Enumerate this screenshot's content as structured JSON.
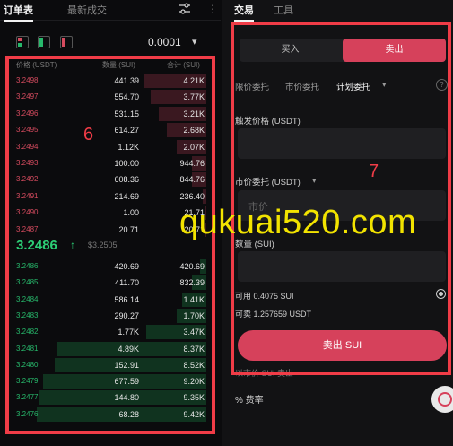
{
  "left_tabs": {
    "orderbook": "订单表",
    "trades": "最新成交"
  },
  "precision": "0.0001",
  "book_header": {
    "price": "价格 (USDT)",
    "qty": "数量 (SUI)",
    "total": "合计 (SUI)"
  },
  "asks": [
    {
      "price": "3.2498",
      "qty": "441.39",
      "total": "4.21K",
      "depth": 0.31
    },
    {
      "price": "3.2497",
      "qty": "554.70",
      "total": "3.77K",
      "depth": 0.28
    },
    {
      "price": "3.2496",
      "qty": "531.15",
      "total": "3.21K",
      "depth": 0.24
    },
    {
      "price": "3.2495",
      "qty": "614.27",
      "total": "2.68K",
      "depth": 0.2
    },
    {
      "price": "3.2494",
      "qty": "1.12K",
      "total": "2.07K",
      "depth": 0.15
    },
    {
      "price": "3.2493",
      "qty": "100.00",
      "total": "944.76",
      "depth": 0.07
    },
    {
      "price": "3.2492",
      "qty": "608.36",
      "total": "844.76",
      "depth": 0.07
    },
    {
      "price": "3.2491",
      "qty": "214.69",
      "total": "236.40",
      "depth": 0.02
    },
    {
      "price": "3.2490",
      "qty": "1.00",
      "total": "21.71",
      "depth": 0.01
    },
    {
      "price": "3.2487",
      "qty": "20.71",
      "total": "20.71",
      "depth": 0.01
    }
  ],
  "last_price": "3.2486",
  "mark_price": "$3.2505",
  "bids": [
    {
      "price": "3.2486",
      "qty": "420.69",
      "total": "420.69",
      "depth": 0.03
    },
    {
      "price": "3.2485",
      "qty": "411.70",
      "total": "832.39",
      "depth": 0.07
    },
    {
      "price": "3.2484",
      "qty": "586.14",
      "total": "1.41K",
      "depth": 0.12
    },
    {
      "price": "3.2483",
      "qty": "290.27",
      "total": "1.70K",
      "depth": 0.15
    },
    {
      "price": "3.2482",
      "qty": "1.77K",
      "total": "3.47K",
      "depth": 0.3
    },
    {
      "price": "3.2481",
      "qty": "4.89K",
      "total": "8.37K",
      "depth": 0.75
    },
    {
      "price": "3.2480",
      "qty": "152.91",
      "total": "8.52K",
      "depth": 0.76
    },
    {
      "price": "3.2479",
      "qty": "677.59",
      "total": "9.20K",
      "depth": 0.82
    },
    {
      "price": "3.2477",
      "qty": "144.80",
      "total": "9.35K",
      "depth": 0.84
    },
    {
      "price": "3.2476",
      "qty": "68.28",
      "total": "9.42K",
      "depth": 0.85
    }
  ],
  "right_tabs": {
    "trade": "交易",
    "tools": "工具"
  },
  "side": {
    "buy": "买入",
    "sell": "卖出"
  },
  "order_types": {
    "limit": "限价委托",
    "market": "市价委托",
    "plan": "计划委托"
  },
  "help_icon": "?",
  "trigger_label": "触发价格 (USDT)",
  "market_label": "市价委托 (USDT)",
  "market_placeholder": "市价",
  "qty_label": "数量 (SUI)",
  "available": "可用 0.4075 SUI",
  "sellable": "可卖 1.257659 USDT",
  "sell_button": "卖出 SUI",
  "below_text": "以市价 SUI 卖出",
  "fee_label": "% 费率",
  "annotations": {
    "left_number": "6",
    "right_number": "7"
  },
  "watermark": "qukuai520.com",
  "colors": {
    "ask": "#d64b5f",
    "bid": "#27b86b",
    "annotation": "#f03c47",
    "watermark": "#f2e300"
  }
}
